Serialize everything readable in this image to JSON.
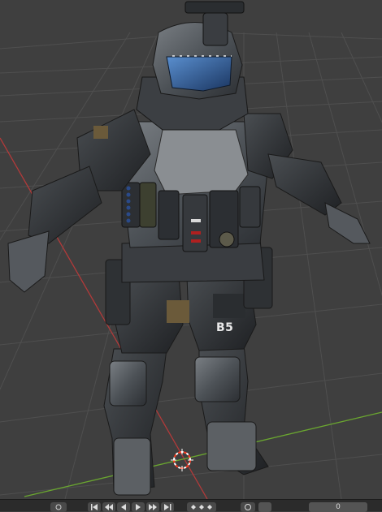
{
  "app": {
    "name": "3D viewport",
    "colors": {
      "background": "#3f3f3f",
      "grid_line": "#505050",
      "x_axis": "#b23a3a",
      "y_axis": "#6aa630",
      "cursor": "#ff3b1f",
      "timeline": "#2b2b2b"
    }
  },
  "model": {
    "decal_text": "B5",
    "description_icon": "armored-soldier-model"
  },
  "timeline": {
    "controls": [
      {
        "name": "jump-start-icon"
      },
      {
        "name": "jump-keyframe-back-icon"
      },
      {
        "name": "play-reverse-icon"
      },
      {
        "name": "play-icon"
      },
      {
        "name": "jump-keyframe-forward-icon"
      },
      {
        "name": "jump-end-icon"
      }
    ],
    "current_frame": "0",
    "frame_start_label": "",
    "frame_end_label": ""
  }
}
